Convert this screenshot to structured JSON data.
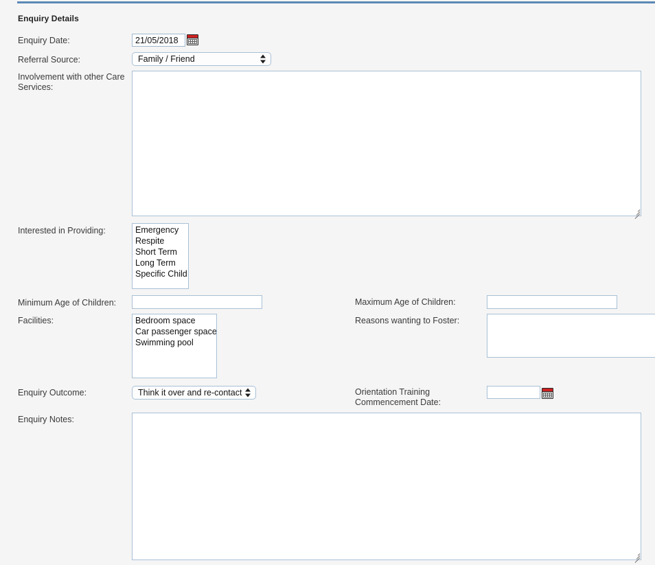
{
  "theme": {
    "accent": "#5b88b5",
    "page_bg": "#f5f5f5",
    "field_border": "#a8c0d6",
    "calendar_icon_bar": "#cc2222"
  },
  "section": {
    "title": "Enquiry Details"
  },
  "fields": {
    "enquiry_date": {
      "label": "Enquiry Date:",
      "value": "21/05/2018",
      "placeholder": "",
      "icon": "calendar-icon"
    },
    "referral_source": {
      "label": "Referral Source:",
      "selected": "Family / Friend"
    },
    "involvement": {
      "label": "Involvement with other Care\nServices:",
      "value": "",
      "placeholder": ""
    },
    "interested_in_providing": {
      "label": "Interested in Providing:",
      "options": [
        "Emergency",
        "Respite",
        "Short Term",
        "Long Term",
        "Specific Child"
      ]
    },
    "minimum_age": {
      "label": "Minimum Age of Children:",
      "value": "",
      "placeholder": ""
    },
    "maximum_age": {
      "label": "Maximum Age of Children:",
      "value": "",
      "placeholder": ""
    },
    "facilities": {
      "label": "Facilities:",
      "options": [
        "Bedroom space",
        "Car passenger space",
        "Swimming pool"
      ]
    },
    "reasons_wanting_to_foster": {
      "label": "Reasons wanting to Foster:",
      "value": "",
      "placeholder": ""
    },
    "enquiry_outcome": {
      "label": "Enquiry Outcome:",
      "selected": "Think it over and re-contact"
    },
    "orientation_training_date": {
      "label": "Orientation Training\nCommencement Date:",
      "value": "",
      "placeholder": "",
      "icon": "calendar-icon"
    },
    "enquiry_notes": {
      "label": "Enquiry Notes:",
      "value": "",
      "placeholder": ""
    }
  }
}
